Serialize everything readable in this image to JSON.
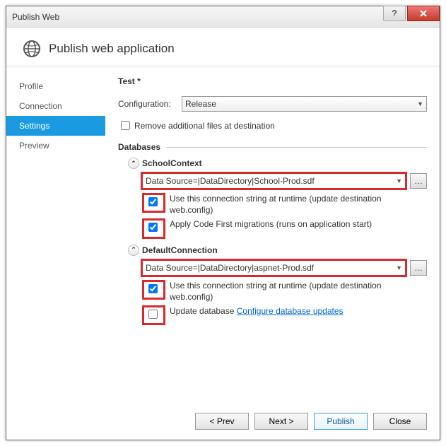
{
  "window": {
    "title": "Publish Web",
    "header": "Publish web application"
  },
  "nav": {
    "profile": "Profile",
    "connection": "Connection",
    "settings": "Settings",
    "preview": "Preview"
  },
  "main": {
    "title": "Test *",
    "config_label": "Configuration:",
    "config_value": "Release",
    "remove_files": "Remove additional files at destination",
    "databases_label": "Databases"
  },
  "db1": {
    "name": "SchoolContext",
    "conn": "Data Source=|DataDirectory|School-Prod.sdf",
    "use_runtime": "Use this connection string at runtime (update destination web.config)",
    "migrations": "Apply Code First migrations (runs on application start)"
  },
  "db2": {
    "name": "DefaultConnection",
    "conn": "Data Source=|DataDirectory|aspnet-Prod.sdf",
    "use_runtime": "Use this connection string at runtime (update destination web.config)",
    "update_db": "Update database",
    "configure_link": "Configure database updates"
  },
  "footer": {
    "prev": "< Prev",
    "next": "Next >",
    "publish": "Publish",
    "close": "Close"
  }
}
